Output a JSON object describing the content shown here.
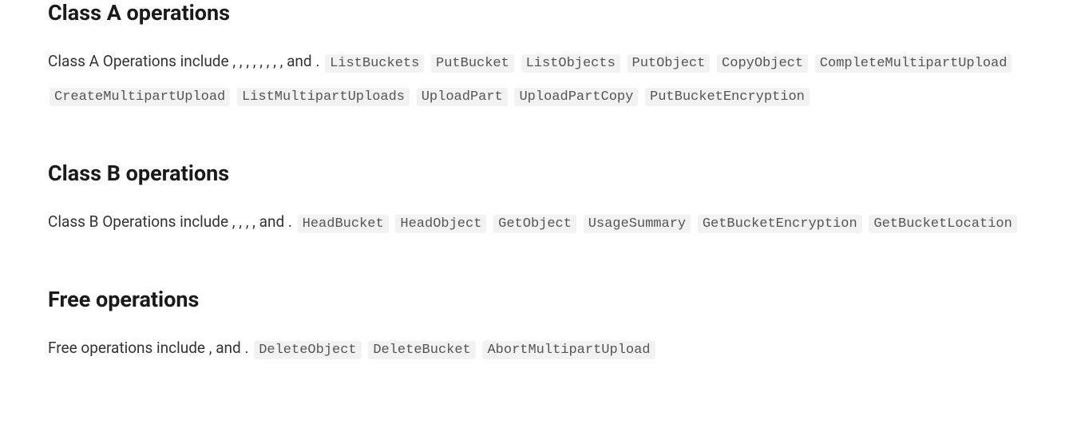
{
  "sections": [
    {
      "heading": "Class A operations",
      "intro_prefix": "Class A Operations include",
      "joiner": ",",
      "last_joiner": "and",
      "terminator": ".",
      "ops": [
        "ListBuckets",
        "PutBucket",
        "ListObjects",
        "PutObject",
        "CopyObject",
        "CompleteMultipartUpload",
        "CreateMultipartUpload",
        "ListMultipartUploads",
        "UploadPart",
        "UploadPartCopy",
        "PutBucketEncryption"
      ]
    },
    {
      "heading": "Class B operations",
      "intro_prefix": "Class B Operations include",
      "joiner": ",",
      "last_joiner": "and",
      "terminator": ".",
      "ops": [
        "HeadBucket",
        "HeadObject",
        "GetObject",
        "UsageSummary",
        "GetBucketEncryption",
        "GetBucketLocation"
      ]
    },
    {
      "heading": "Free operations",
      "intro_prefix": "Free operations include",
      "joiner": ",",
      "last_joiner": "and",
      "terminator": ".",
      "ops": [
        "DeleteObject",
        "DeleteBucket",
        "AbortMultipartUpload"
      ]
    }
  ]
}
